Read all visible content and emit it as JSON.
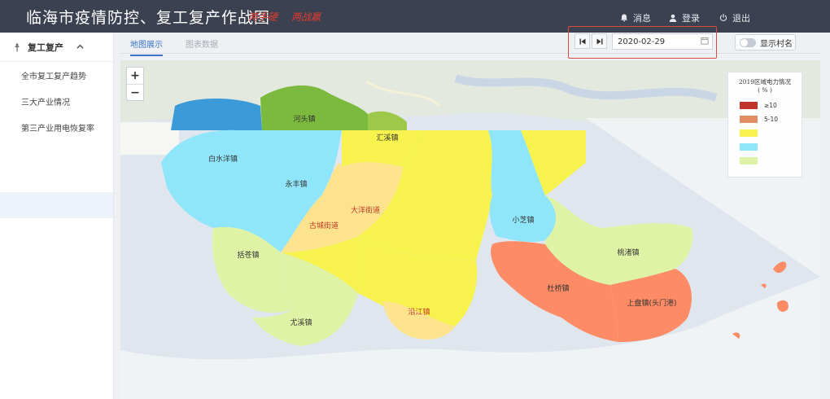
{
  "header": {
    "title": "临海市疫情防控、复工复产作战图",
    "slogans": [
      "两手硬",
      "两战赢"
    ],
    "messages_label": "消息",
    "login_label": "登录",
    "logout_label": "退出"
  },
  "sidebar": {
    "section_label": "复工复产",
    "items": [
      {
        "label": "全市复工复产趋势"
      },
      {
        "label": "三大产业情况"
      },
      {
        "label": "第三产业用电恢复率"
      }
    ]
  },
  "tabs": [
    {
      "label": "地图展示",
      "active": true
    },
    {
      "label": "图表数据",
      "active": false
    }
  ],
  "controls": {
    "date_value": "2020-02-29",
    "show_village_label": "显示村名"
  },
  "map": {
    "towns": [
      {
        "name": "河头镇",
        "color": "#7cba3f"
      },
      {
        "name": "汇溪镇",
        "color": "#f7f24e"
      },
      {
        "name": "白水洋镇",
        "color": "#8fe6fb"
      },
      {
        "name": "永丰镇",
        "color": "#8fe6fb"
      },
      {
        "name": "括苍镇",
        "color": "#dff3a6"
      },
      {
        "name": "大洋街道",
        "color": "#fde38e"
      },
      {
        "name": "古城街道",
        "color": "#fde38e"
      },
      {
        "name": "小芝镇",
        "color": "#8fe6fb"
      },
      {
        "name": "桃渚镇",
        "color": "#dff3a6"
      },
      {
        "name": "杜桥镇",
        "color": "#fd8c66"
      },
      {
        "name": "上盘镇(头门港)",
        "color": "#fd8c66"
      },
      {
        "name": "沿江镇",
        "color": "#fde38e"
      },
      {
        "name": "尤溪镇",
        "color": "#dff3a6"
      }
    ]
  },
  "legend": {
    "title": "2019区域电力情况",
    "subtitle": "( % )",
    "items": [
      {
        "label": "≥10",
        "color": "#c2332c"
      },
      {
        "label": "5-10",
        "color": "#e08e62"
      },
      {
        "label": "",
        "color": "#f7f24e"
      },
      {
        "label": "",
        "color": "#8fe6fb"
      },
      {
        "label": "",
        "color": "#dff3a6"
      }
    ]
  },
  "icons": {
    "messages": "bell-icon",
    "login": "user-icon",
    "logout": "power-icon",
    "sidebar_section": "pin-icon",
    "collapse": "chevron-up-icon",
    "first": "skip-first-icon",
    "last": "skip-last-icon",
    "calendar": "calendar-icon"
  }
}
